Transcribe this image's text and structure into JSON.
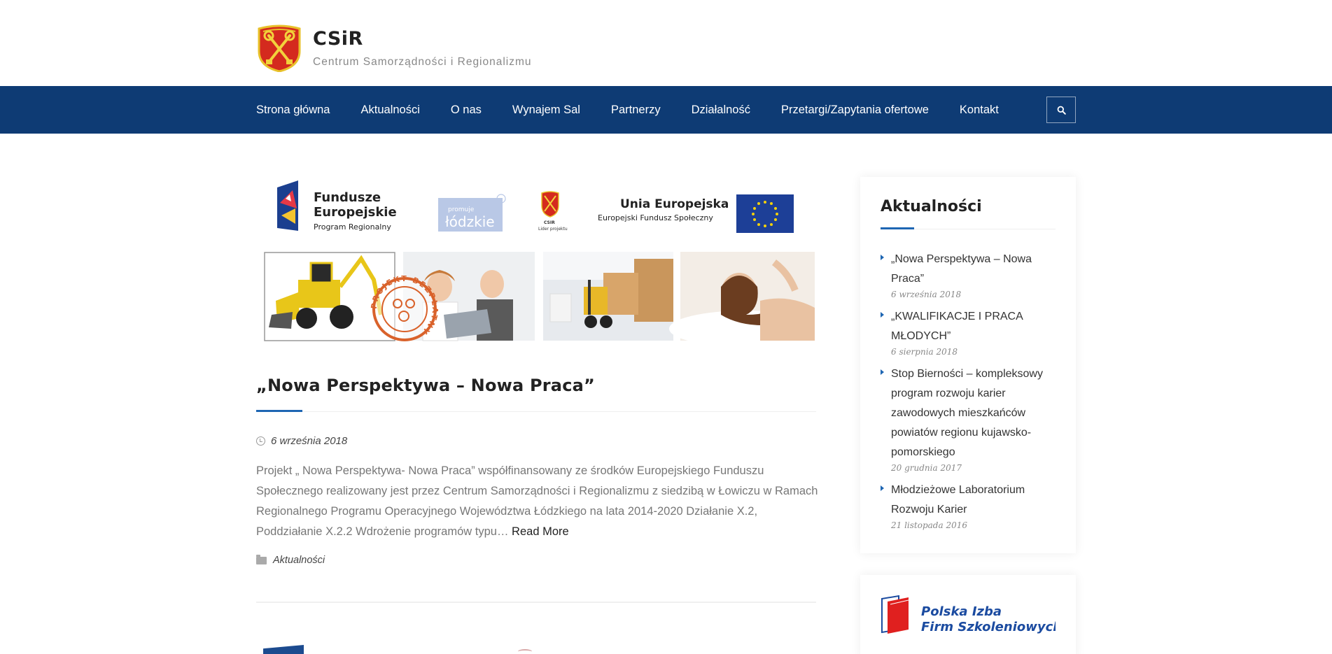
{
  "header": {
    "site_title": "CSiR",
    "tagline": "Centrum Samorządności i Regionalizmu"
  },
  "nav": {
    "items": [
      "Strona główna",
      "Aktualności",
      "O nas",
      "Wynajem Sal",
      "Partnerzy",
      "Działalność",
      "Przetargi/Zapytania ofertowe",
      "Kontakt"
    ],
    "search_icon": "search-icon"
  },
  "banner": {
    "fe_line1": "Fundusze",
    "fe_line2": "Europejskie",
    "fe_line3": "Program Regionalny",
    "promuje": "promuje",
    "lodzkie": "łódzkie",
    "csir_small": "CSIR",
    "lider": "Lider projektu",
    "ue_line1": "Unia Europejska",
    "ue_line2": "Europejski Fundusz Społeczny",
    "stamp_text": "PROJEKT BEZPŁATNY"
  },
  "post": {
    "title": "„Nowa Perspektywa – Nowa Praca”",
    "date": "6 września 2018",
    "excerpt": "Projekt „ Nowa Perspektywa- Nowa Praca” współfinansowany ze środków Europejskiego Funduszu Społecznego realizowany jest przez Centrum Samorządności i Regionalizmu z siedzibą w Łowiczu w Ramach Regionalnego Programu Operacyjnego Województwa Łódzkiego na lata 2014-2020 Działanie X.2, Poddziałanie X.2.2 Wdrożenie programów typu…",
    "read_more": "Read More",
    "category": "Aktualności"
  },
  "sidebar": {
    "widget_title": "Aktualności",
    "items": [
      {
        "title": "„Nowa Perspektywa – Nowa Praca”",
        "date": "6 września 2018"
      },
      {
        "title": "„KWALIFIKACJE I PRACA MŁODYCH”",
        "date": "6 sierpnia 2018"
      },
      {
        "title": "Stop Bierności – kompleksowy program rozwoju karier zawodowych mieszkańców powiatów regionu kujawsko-pomorskiego",
        "date": "20 grudnia 2017"
      },
      {
        "title": "Młodzieżowe Laboratorium Rozwoju Karier",
        "date": "21 listopada 2016"
      }
    ],
    "partner_logo_line1": "Polska Izba",
    "partner_logo_line2": "Firm Szkoleniowych"
  },
  "colors": {
    "nav_bg": "#0e3b74",
    "accent": "#1e66b3"
  }
}
